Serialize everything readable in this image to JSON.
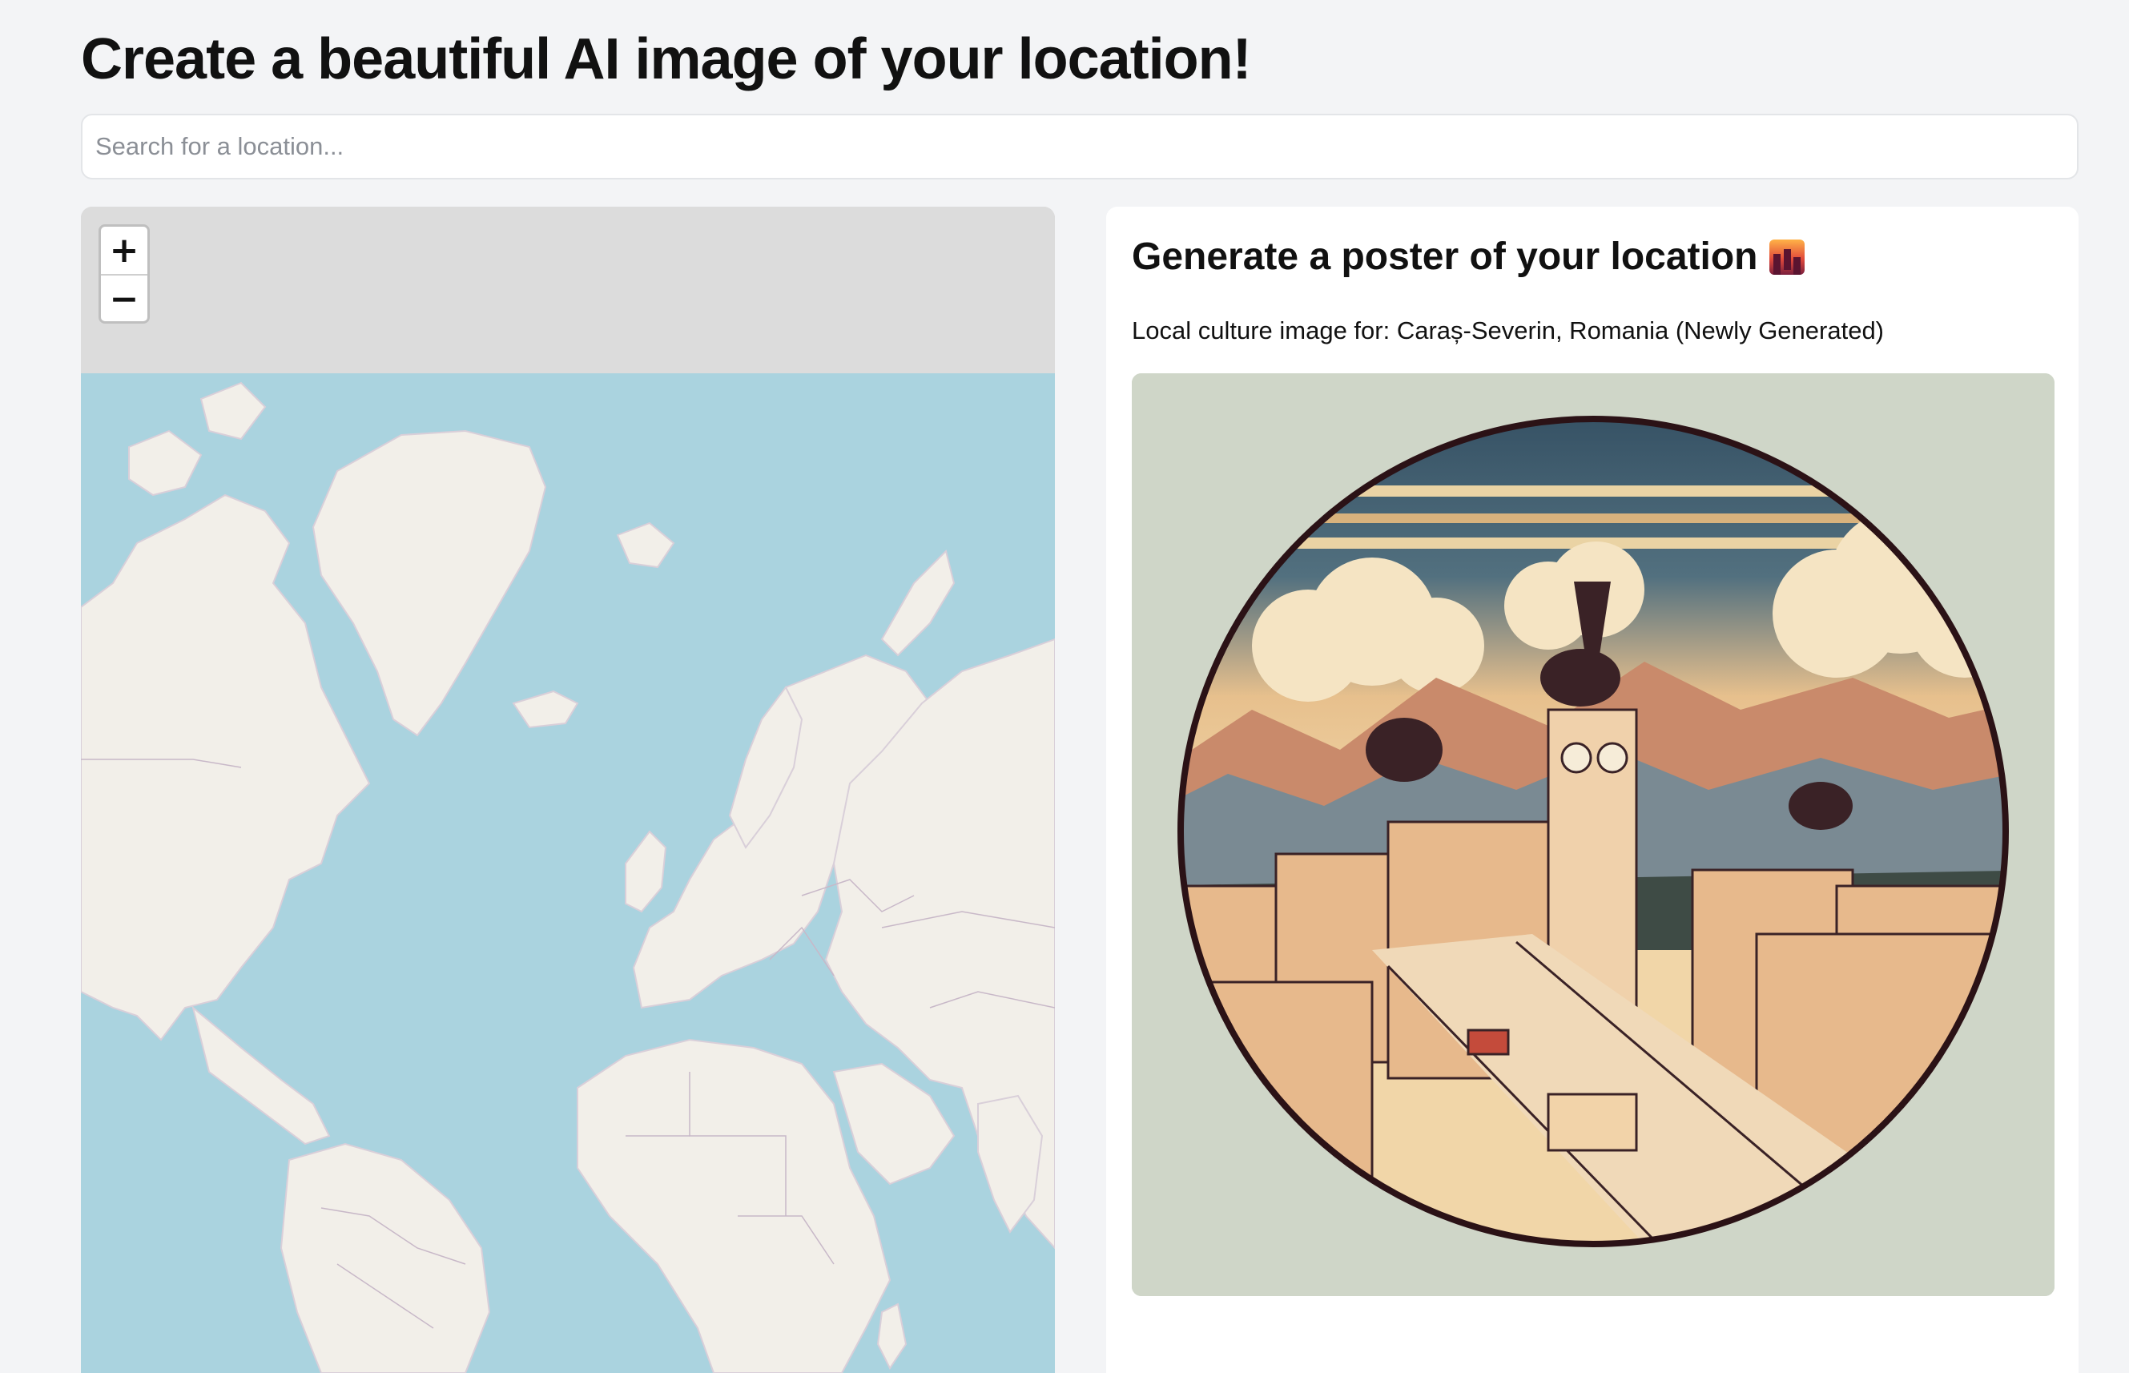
{
  "header": {
    "title": "Create a beautiful AI image of your location!"
  },
  "search": {
    "placeholder": "Search for a location...",
    "value": ""
  },
  "map": {
    "zoom_in_label": "+",
    "zoom_out_label": "−",
    "colors": {
      "ocean": "#aad3df",
      "land": "#f2efe9",
      "border": "#c8b8c8",
      "nodata": "#dcdcdc"
    }
  },
  "poster": {
    "title": "Generate a poster of your location",
    "title_icon": "city-sunset-icon",
    "subtitle": "Local culture image for: Caraș-Severin, Romania (Newly Generated)",
    "image_icon": "city-illustration-image"
  }
}
